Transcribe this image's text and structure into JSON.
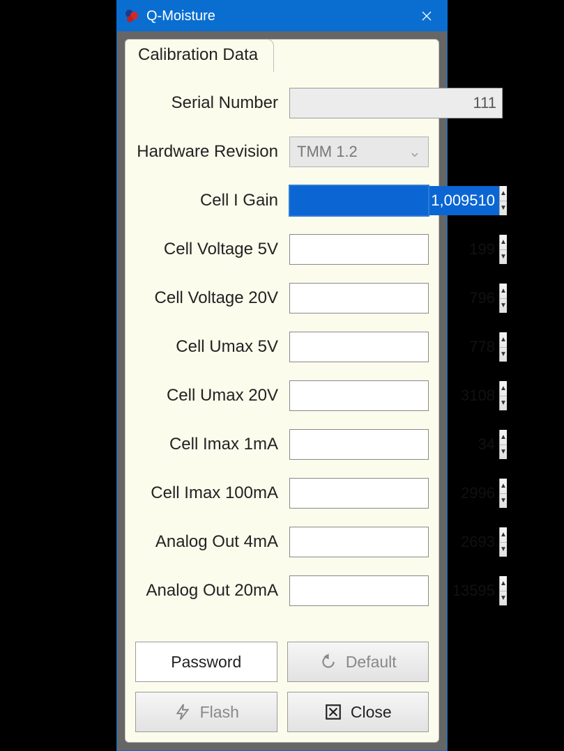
{
  "window": {
    "title": "Q-Moisture"
  },
  "tab": {
    "label": "Calibration Data"
  },
  "fields": {
    "serial": {
      "label": "Serial Number",
      "value": "111"
    },
    "hwrev": {
      "label": "Hardware Revision",
      "value": "TMM 1.2"
    },
    "gain": {
      "label": "Cell I Gain",
      "value": "1,009510"
    },
    "cv5": {
      "label": "Cell Voltage 5V",
      "value": "199"
    },
    "cv20": {
      "label": "Cell Voltage 20V",
      "value": "796"
    },
    "umax5": {
      "label": "Cell Umax 5V",
      "value": "778"
    },
    "umax20": {
      "label": "Cell Umax 20V",
      "value": "3108"
    },
    "imax1": {
      "label": "Cell Imax 1mA",
      "value": "34"
    },
    "imax100": {
      "label": "Cell Imax 100mA",
      "value": "2996"
    },
    "ao4": {
      "label": "Analog Out 4mA",
      "value": "2693"
    },
    "ao20": {
      "label": "Analog Out 20mA",
      "value": "13595"
    }
  },
  "buttons": {
    "password": "Password",
    "default": "Default",
    "flash": "Flash",
    "close": "Close"
  }
}
